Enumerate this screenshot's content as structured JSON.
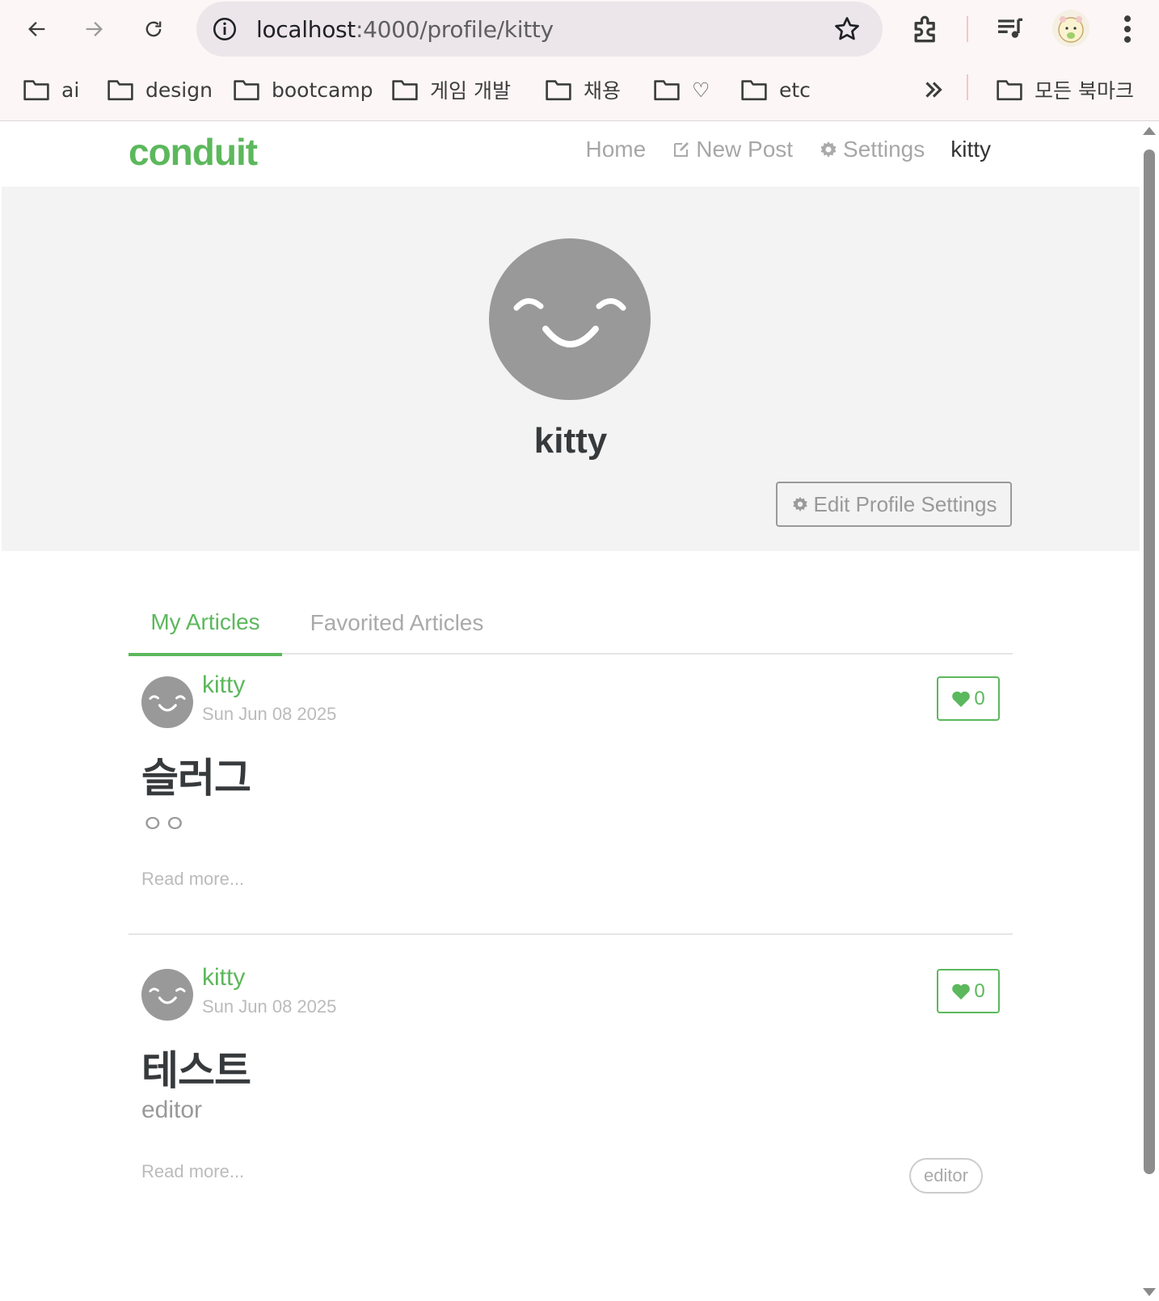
{
  "browser": {
    "url_host": "localhost",
    "url_path": ":4000/profile/kitty",
    "bookmarks": [
      "ai",
      "design",
      "bootcamp",
      "게임 개발",
      "채용",
      "♡",
      "etc"
    ],
    "all_bookmarks": "모든 북마크"
  },
  "navbar": {
    "brand": "conduit",
    "links": {
      "home": "Home",
      "new_post": "New Post",
      "settings": "Settings",
      "user": "kitty"
    }
  },
  "profile": {
    "username": "kitty",
    "edit_button": "Edit Profile Settings"
  },
  "tabs": {
    "my_articles": "My Articles",
    "favorited": "Favorited Articles"
  },
  "articles": [
    {
      "author": "kitty",
      "date": "Sun Jun 08 2025",
      "favorites": "0",
      "title": "슬러그",
      "description": "ㅇㅇ",
      "read_more": "Read more...",
      "tags": []
    },
    {
      "author": "kitty",
      "date": "Sun Jun 08 2025",
      "favorites": "0",
      "title": "테스트",
      "description": "editor",
      "read_more": "Read more...",
      "tags": [
        "editor"
      ]
    }
  ],
  "colors": {
    "brand": "#5cb85c",
    "banner_bg": "#f3f3f3",
    "avatar": "#999999"
  }
}
